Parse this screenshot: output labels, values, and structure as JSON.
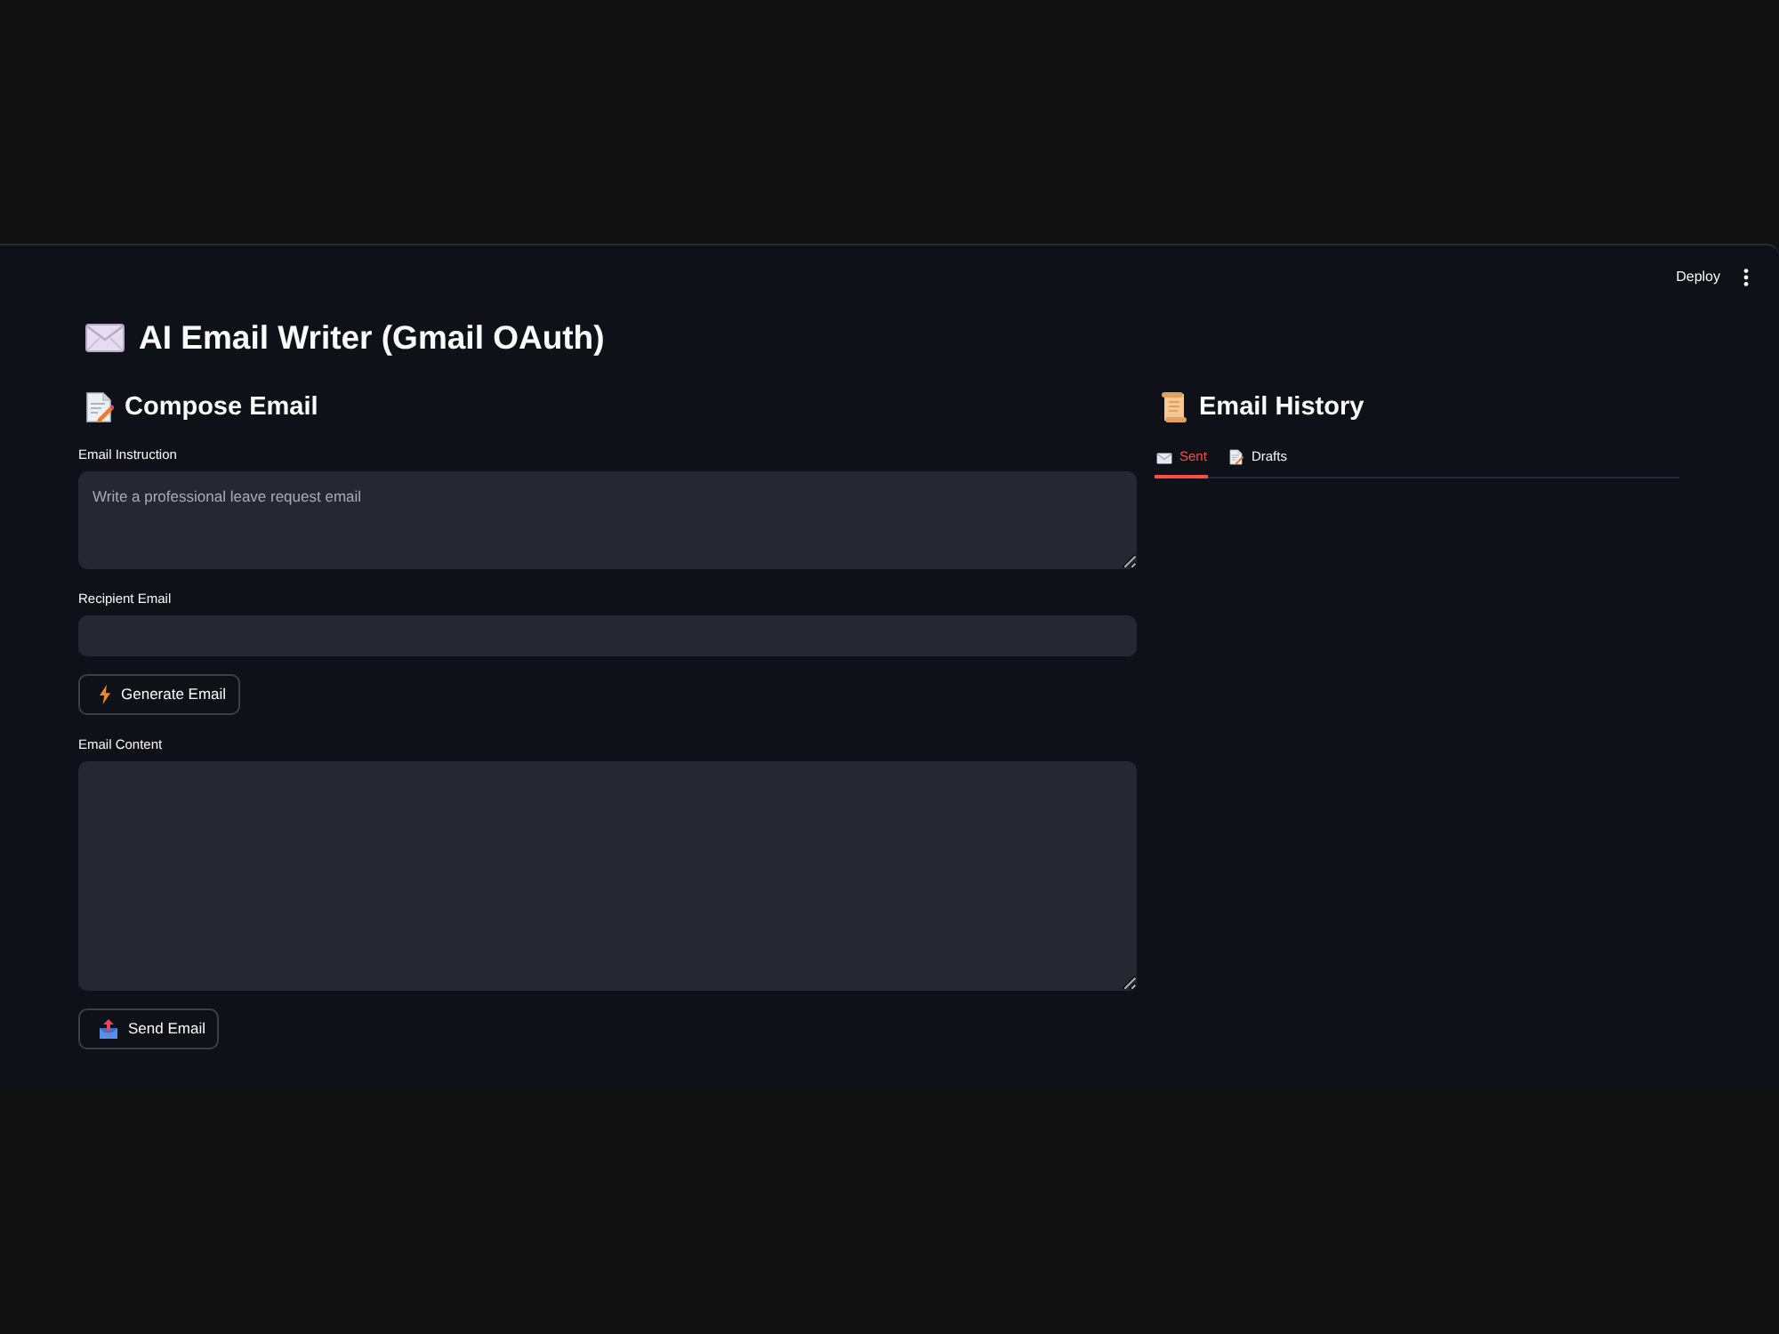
{
  "toolbar": {
    "deploy": "Deploy"
  },
  "title": "AI Email Writer (Gmail OAuth)",
  "compose": {
    "heading": "Compose Email",
    "items": [
      {
        "kind": "textarea",
        "label": "Email Instruction",
        "placeholder": "Write a professional leave request email"
      },
      {
        "kind": "input",
        "label": "Recipient Email"
      },
      {
        "kind": "button",
        "label": "Generate Email"
      },
      {
        "kind": "textarea",
        "label": "Email Content"
      },
      {
        "kind": "button",
        "label": "Send Email"
      }
    ]
  },
  "history": {
    "heading": "Email History",
    "tabs": [
      {
        "label": "Sent",
        "selected": true
      },
      {
        "label": "Drafts",
        "selected": false
      }
    ]
  }
}
